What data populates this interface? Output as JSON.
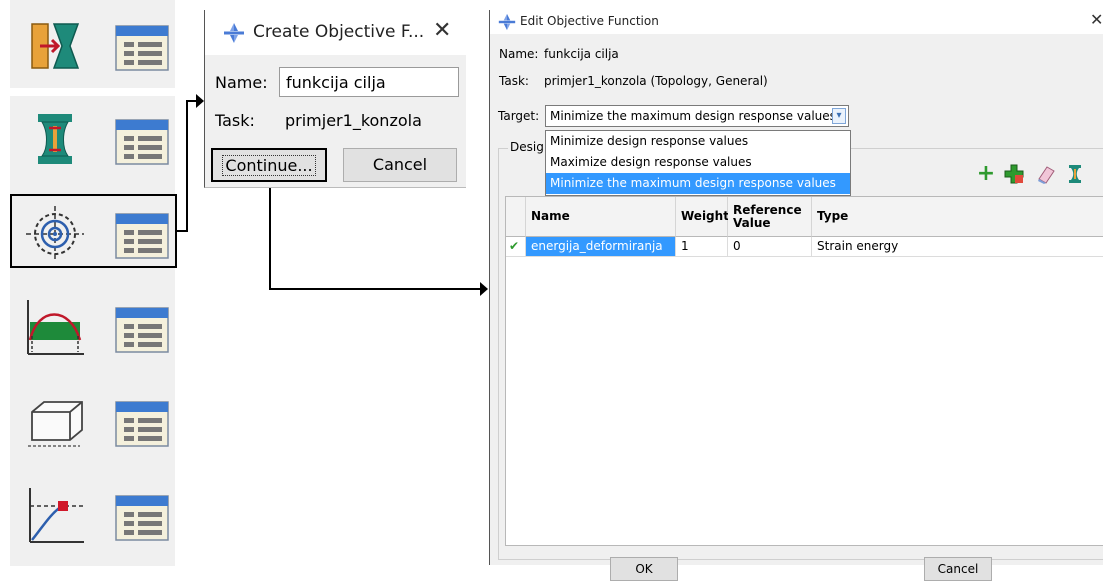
{
  "toolbox": {
    "tools": [
      {
        "icon": "design-response-create-icon",
        "manager_icon": "design-response-manager-icon"
      },
      {
        "icon": "constraint-create-icon",
        "manager_icon": "constraint-manager-icon"
      },
      {
        "icon": "objective-function-create-icon",
        "manager_icon": "objective-function-manager-icon"
      },
      {
        "icon": "geometric-restriction-create-icon",
        "manager_icon": "geometric-restriction-manager-icon"
      },
      {
        "icon": "stop-condition-create-icon",
        "manager_icon": "stop-condition-manager-icon"
      },
      {
        "icon": "optimization-task-create-icon",
        "manager_icon": "optimization-task-manager-icon"
      }
    ]
  },
  "create_dialog": {
    "title": "Create Objective F...",
    "name_label": "Name:",
    "name_value": "funkcija cilja",
    "task_label": "Task:",
    "task_value": "primjer1_konzola",
    "continue_label": "Continue...",
    "cancel_label": "Cancel"
  },
  "edit_dialog": {
    "title": "Edit Objective Function",
    "name_label": "Name:",
    "name_value": "funkcija cilja",
    "task_label": "Task:",
    "task_value": "primjer1_konzola (Topology, General)",
    "target_label": "Target:",
    "target_value": "Minimize the maximum design response values",
    "target_options": [
      "Minimize design response values",
      "Maximize design response values",
      "Minimize the maximum design response values"
    ],
    "group_label": "Desig",
    "table": {
      "columns": [
        "Name",
        "Weight",
        "Reference Value",
        "Type"
      ],
      "rows": [
        {
          "checked": "✔",
          "name": "energija_deformiranja",
          "weight": "1",
          "reference_value": "0",
          "type": "Strain energy"
        }
      ]
    },
    "ok_label": "OK",
    "cancel_label": "Cancel"
  },
  "colors": {
    "selection_blue": "#3399ff",
    "dialog_bg": "#f0f0f0",
    "add_green": "#2e9a2e",
    "icon_orange": "#e8a23a",
    "icon_teal": "#1e8a7a"
  }
}
